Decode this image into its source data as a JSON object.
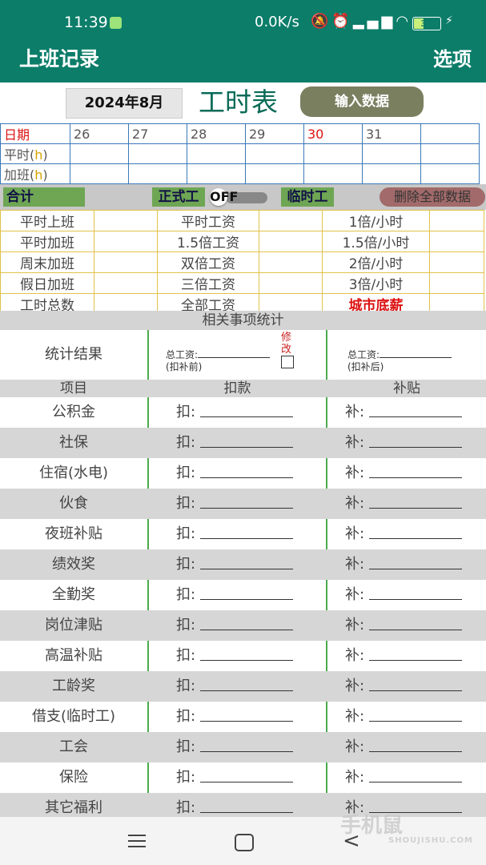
{
  "status": {
    "time": "11:39",
    "net": "0.0K/s",
    "battery": "39"
  },
  "appbar": {
    "title": "上班记录",
    "menu": "选项"
  },
  "header": {
    "month": "2024年8月",
    "title": "工时表",
    "input_button": "输入数据"
  },
  "calendar": {
    "date_label": "日期",
    "days": [
      "26",
      "27",
      "28",
      "29",
      "30",
      "31",
      ""
    ],
    "normal_label": "平时(",
    "overtime_label": "加班(",
    "unit": "h",
    "close": ")"
  },
  "summary": {
    "total": "合计",
    "formal": "正式工",
    "toggle": "OFF",
    "temp": "临时工",
    "delete": "删除全部数据"
  },
  "wage_rows": [
    [
      "平时上班",
      "平时工资",
      "1倍/小时"
    ],
    [
      "平时加班",
      "1.5倍工资",
      "1.5倍/小时"
    ],
    [
      "周末加班",
      "双倍工资",
      "2倍/小时"
    ],
    [
      "假日加班",
      "三倍工资",
      "3倍/小时"
    ],
    [
      "工时总数",
      "全部工资",
      "城市底薪"
    ]
  ],
  "stats": {
    "heading": "相关事项统计",
    "result_label": "统计结果",
    "total_wage": "总工资:",
    "before": "(扣补前)",
    "after": "(扣补后)",
    "edit": "修改",
    "col_item": "项目",
    "col_deduct": "扣款",
    "col_subsidy": "补贴",
    "deduct_prefix": "扣:",
    "subsidy_prefix": "补:",
    "items": [
      "公积金",
      "社保",
      "住宿(水电)",
      "伙食",
      "夜班补贴",
      "绩效奖",
      "全勤奖",
      "岗位津贴",
      "高温补贴",
      "工龄奖",
      "借支(临时工)",
      "工会",
      "保险",
      "其它福利"
    ]
  },
  "watermark": {
    "main": "手机鼠",
    "sub": "SHOUJISHU.COM"
  },
  "colors": {
    "primary": "#0b7d69",
    "accent_green": "#6ea654",
    "red": "#dd1111"
  }
}
